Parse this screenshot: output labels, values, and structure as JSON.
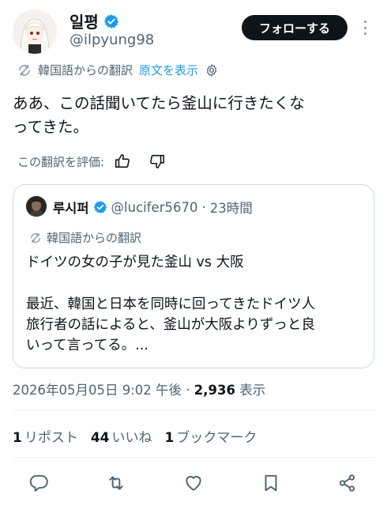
{
  "author": {
    "display_name": "일평",
    "handle": "@ilpyung98",
    "avatar_icon": "anime-girl-avatar-icon"
  },
  "follow_button": "フォローする",
  "translation": {
    "label": "韓国語からの翻訳",
    "show_original": "原文を表示",
    "rate_label": "この翻訳を評価:"
  },
  "tweet": {
    "line1": "ああ、この話聞いてたら釜山に行きたくな",
    "line2": "ってきた。"
  },
  "quote": {
    "display_name": "루시퍼",
    "handle": "@lucifer5670",
    "separator": "·",
    "time": "23時間",
    "translation_label": "韓国語からの翻訳",
    "title": "ドイツの女の子が見た釜山 vs 大阪",
    "body_line1": "最近、韓国と日本を同時に回ってきたドイツ人",
    "body_line2": "旅行者の話によると、釜山が大阪よりずっと良",
    "body_line3": "いって言ってる。..."
  },
  "meta": {
    "datetime": "2026年05月05日 9:02 午後",
    "separator": "·",
    "views": "2,936",
    "views_label": "表示"
  },
  "stats": {
    "reposts_count": "1",
    "reposts_label": "リポスト",
    "likes_count": "44",
    "likes_label": "いいね",
    "bookmarks_count": "1",
    "bookmarks_label": "ブックマーク"
  },
  "colors": {
    "accent": "#1d9bf0",
    "text": "#0f1419",
    "secondary": "#536471",
    "border": "#cfd9de"
  }
}
